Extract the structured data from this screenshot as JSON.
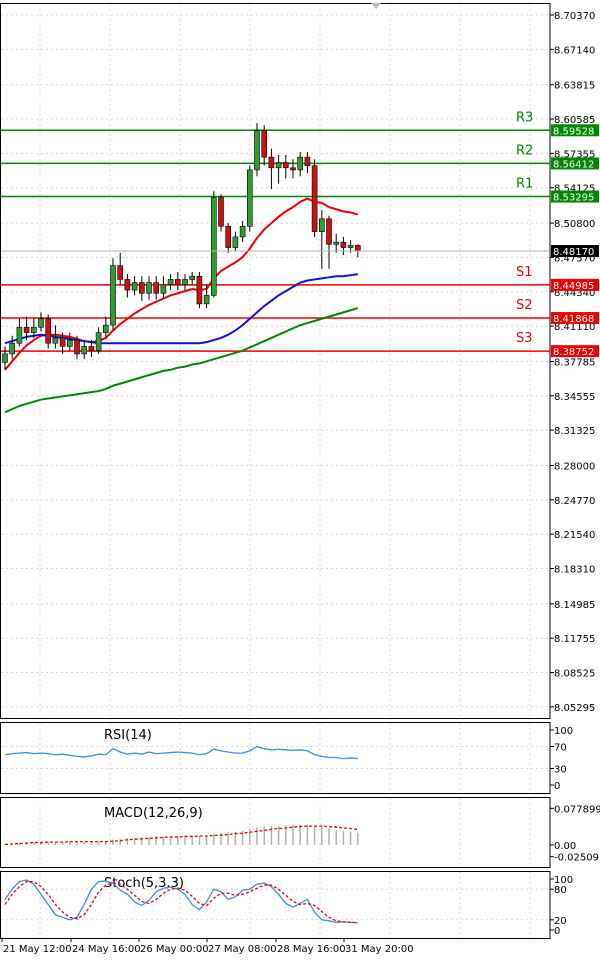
{
  "chart_data": [
    {
      "type": "candlestick",
      "title": "",
      "x_labels": [
        "21 May 12:00",
        "24 May 16:00",
        "26 May 00:00",
        "27 May 08:00",
        "28 May 16:00",
        "31 May 20:00"
      ],
      "ylim": [
        8.0425,
        8.715
      ],
      "y_ticks": [
        "8.70370",
        "8.67140",
        "8.63815",
        "8.60585",
        "8.57355",
        "8.54125",
        "8.50800",
        "8.47570",
        "8.44340",
        "8.41110",
        "8.37785",
        "8.34555",
        "8.31325",
        "8.28000",
        "8.24770",
        "8.21540",
        "8.18310",
        "8.14985",
        "8.11755",
        "8.08525",
        "8.05295"
      ],
      "grid": true,
      "candles": [
        [
          8.377,
          8.385,
          8.392,
          8.37
        ],
        [
          8.385,
          8.395,
          8.402,
          8.38
        ],
        [
          8.395,
          8.41,
          8.418,
          8.392
        ],
        [
          8.41,
          8.405,
          8.42,
          8.398
        ],
        [
          8.405,
          8.41,
          8.418,
          8.4
        ],
        [
          8.41,
          8.418,
          8.424,
          8.406
        ],
        [
          8.418,
          8.395,
          8.422,
          8.39
        ],
        [
          8.395,
          8.4,
          8.412,
          8.39
        ],
        [
          8.4,
          8.392,
          8.405,
          8.385
        ],
        [
          8.392,
          8.398,
          8.405,
          8.388
        ],
        [
          8.398,
          8.385,
          8.402,
          8.38
        ],
        [
          8.385,
          8.392,
          8.398,
          8.38
        ],
        [
          8.392,
          8.388,
          8.398,
          8.382
        ],
        [
          8.388,
          8.405,
          8.41,
          8.385
        ],
        [
          8.405,
          8.412,
          8.42,
          8.4
        ],
        [
          8.412,
          8.468,
          8.475,
          8.408
        ],
        [
          8.468,
          8.455,
          8.48,
          8.45
        ],
        [
          8.455,
          8.445,
          8.46,
          8.438
        ],
        [
          8.445,
          8.452,
          8.458,
          8.44
        ],
        [
          8.452,
          8.442,
          8.458,
          8.435
        ],
        [
          8.442,
          8.452,
          8.458,
          8.436
        ],
        [
          8.452,
          8.442,
          8.458,
          8.436
        ],
        [
          8.442,
          8.45,
          8.458,
          8.438
        ],
        [
          8.45,
          8.455,
          8.46,
          8.445
        ],
        [
          8.455,
          8.45,
          8.462,
          8.445
        ],
        [
          8.45,
          8.455,
          8.46,
          8.445
        ],
        [
          8.455,
          8.458,
          8.462,
          8.45
        ],
        [
          8.458,
          8.432,
          8.462,
          8.428
        ],
        [
          8.432,
          8.44,
          8.45,
          8.428
        ],
        [
          8.44,
          8.532,
          8.538,
          8.438
        ],
        [
          8.532,
          8.505,
          8.535,
          8.5
        ],
        [
          8.505,
          8.485,
          8.508,
          8.48
        ],
        [
          8.485,
          8.495,
          8.5,
          8.482
        ],
        [
          8.495,
          8.505,
          8.51,
          8.49
        ],
        [
          8.505,
          8.558,
          8.562,
          8.5
        ],
        [
          8.558,
          8.595,
          8.602,
          8.552
        ],
        [
          8.595,
          8.57,
          8.6,
          8.562
        ],
        [
          8.57,
          8.56,
          8.578,
          8.54
        ],
        [
          8.56,
          8.565,
          8.572,
          8.545
        ],
        [
          8.565,
          8.56,
          8.572,
          8.55
        ],
        [
          8.56,
          8.558,
          8.568,
          8.55
        ],
        [
          8.558,
          8.57,
          8.575,
          8.552
        ],
        [
          8.57,
          8.562,
          8.575,
          8.555
        ],
        [
          8.562,
          8.5,
          8.568,
          8.495
        ],
        [
          8.5,
          8.512,
          8.52,
          8.465
        ],
        [
          8.512,
          8.488,
          8.515,
          8.465
        ],
        [
          8.488,
          8.49,
          8.498,
          8.48
        ],
        [
          8.49,
          8.485,
          8.495,
          8.478
        ],
        [
          8.485,
          8.487,
          8.492,
          8.48
        ],
        [
          8.487,
          8.482,
          8.488,
          8.476
        ]
      ],
      "series": [
        {
          "name": "",
          "color": "#ee0000",
          "values": [
            8.37,
            8.378,
            8.386,
            8.393,
            8.398,
            8.402,
            8.403,
            8.403,
            8.402,
            8.401,
            8.399,
            8.397,
            8.396,
            8.397,
            8.4,
            8.407,
            8.413,
            8.418,
            8.423,
            8.427,
            8.431,
            8.434,
            8.437,
            8.44,
            8.442,
            8.444,
            8.446,
            8.445,
            8.446,
            8.456,
            8.463,
            8.467,
            8.471,
            8.476,
            8.484,
            8.494,
            8.502,
            8.508,
            8.514,
            8.519,
            8.523,
            8.528,
            8.531,
            8.528,
            8.527,
            8.523,
            8.521,
            8.519,
            8.518,
            8.516
          ]
        },
        {
          "name": "",
          "color": "#1010dd",
          "values": [
            8.395,
            8.397,
            8.399,
            8.401,
            8.402,
            8.403,
            8.402,
            8.401,
            8.4,
            8.399,
            8.398,
            8.397,
            8.396,
            8.395,
            8.395,
            8.395,
            8.395,
            8.395,
            8.395,
            8.395,
            8.395,
            8.395,
            8.395,
            8.395,
            8.395,
            8.395,
            8.395,
            8.395,
            8.396,
            8.398,
            8.4,
            8.403,
            8.407,
            8.412,
            8.418,
            8.424,
            8.43,
            8.435,
            8.44,
            8.444,
            8.448,
            8.452,
            8.454,
            8.455,
            8.456,
            8.457,
            8.458,
            8.458,
            8.459,
            8.46
          ]
        },
        {
          "name": "",
          "color": "#008800",
          "values": [
            8.33,
            8.333,
            8.336,
            8.338,
            8.34,
            8.342,
            8.343,
            8.344,
            8.345,
            8.346,
            8.347,
            8.348,
            8.349,
            8.35,
            8.352,
            8.355,
            8.357,
            8.359,
            8.361,
            8.363,
            8.365,
            8.367,
            8.369,
            8.37,
            8.372,
            8.373,
            8.375,
            8.376,
            8.378,
            8.38,
            8.382,
            8.384,
            8.386,
            8.388,
            8.391,
            8.394,
            8.397,
            8.4,
            8.403,
            8.406,
            8.409,
            8.412,
            8.414,
            8.416,
            8.418,
            8.42,
            8.422,
            8.424,
            8.426,
            8.428
          ]
        }
      ],
      "levels": [
        {
          "label": "R3",
          "value": 8.59528,
          "text": "8.59528",
          "color": "#008800"
        },
        {
          "label": "R2",
          "value": 8.56412,
          "text": "8.56412",
          "color": "#008800"
        },
        {
          "label": "R1",
          "value": 8.53295,
          "text": "8.53295",
          "color": "#008800"
        },
        {
          "label": "S1",
          "value": 8.44985,
          "text": "8.44985",
          "color": "#ee0000"
        },
        {
          "label": "S2",
          "value": 8.41868,
          "text": "8.41868",
          "color": "#ee0000"
        },
        {
          "label": "S3",
          "value": 8.38752,
          "text": "8.38752",
          "color": "#ee0000"
        }
      ],
      "current_price": {
        "value": 8.4817,
        "text": "8.48170"
      }
    },
    {
      "type": "line",
      "title": "RSI(14)",
      "ylim": [
        0,
        100
      ],
      "y_ticks": [
        "100",
        "70",
        "30",
        "0"
      ],
      "series": [
        {
          "name": "",
          "color": "#3a8fe0",
          "values": [
            55,
            57,
            58,
            59,
            57,
            58,
            57,
            55,
            56,
            54,
            52,
            51,
            53,
            56,
            55,
            66,
            60,
            56,
            58,
            56,
            60,
            57,
            58,
            59,
            60,
            59,
            58,
            55,
            57,
            65,
            62,
            60,
            58,
            58,
            62,
            70,
            66,
            64,
            65,
            64,
            63,
            64,
            62,
            55,
            52,
            50,
            50,
            48,
            49,
            48
          ]
        }
      ]
    },
    {
      "type": "bar",
      "title": "MACD(12,26,9)",
      "ylim": [
        -0.03,
        0.085
      ],
      "y_ticks": [
        "0.077899",
        "0.00",
        "-0.02509"
      ],
      "series": [
        {
          "name": "",
          "color": "#b0b0b0",
          "values": [
            0.002,
            0.003,
            0.004,
            0.005,
            0.006,
            0.007,
            0.007,
            0.007,
            0.007,
            0.007,
            0.007,
            0.007,
            0.007,
            0.007,
            0.008,
            0.011,
            0.013,
            0.014,
            0.015,
            0.016,
            0.017,
            0.018,
            0.018,
            0.019,
            0.019,
            0.02,
            0.02,
            0.019,
            0.019,
            0.024,
            0.026,
            0.027,
            0.028,
            0.03,
            0.033,
            0.037,
            0.039,
            0.04,
            0.041,
            0.042,
            0.043,
            0.043,
            0.043,
            0.04,
            0.038,
            0.035,
            0.032,
            0.03,
            0.028,
            0.026
          ]
        },
        {
          "name": "",
          "color": "#ee0000",
          "values": [
            0.001,
            0.002,
            0.003,
            0.004,
            0.005,
            0.005,
            0.006,
            0.006,
            0.006,
            0.007,
            0.007,
            0.007,
            0.007,
            0.007,
            0.007,
            0.008,
            0.009,
            0.011,
            0.012,
            0.013,
            0.014,
            0.015,
            0.016,
            0.017,
            0.017,
            0.018,
            0.018,
            0.019,
            0.019,
            0.02,
            0.021,
            0.022,
            0.024,
            0.025,
            0.027,
            0.029,
            0.031,
            0.033,
            0.035,
            0.036,
            0.038,
            0.039,
            0.04,
            0.04,
            0.04,
            0.039,
            0.038,
            0.036,
            0.035,
            0.033
          ]
        }
      ]
    },
    {
      "type": "line",
      "title": "Stoch(5,3,3)",
      "ylim": [
        0,
        100
      ],
      "y_ticks": [
        "100",
        "80",
        "20",
        "0"
      ],
      "series": [
        {
          "name": "",
          "color": "#3a8fe0",
          "values": [
            60,
            80,
            95,
            98,
            90,
            70,
            50,
            30,
            25,
            20,
            25,
            50,
            80,
            95,
            96,
            92,
            78,
            70,
            55,
            48,
            58,
            75,
            82,
            84,
            80,
            70,
            50,
            40,
            55,
            80,
            75,
            60,
            65,
            78,
            80,
            90,
            92,
            85,
            70,
            52,
            45,
            52,
            60,
            35,
            20,
            18,
            15,
            16,
            15,
            14
          ]
        },
        {
          "name": "",
          "color": "#ee0000",
          "values": [
            50,
            70,
            85,
            95,
            95,
            85,
            70,
            50,
            35,
            25,
            22,
            30,
            50,
            75,
            88,
            92,
            90,
            80,
            68,
            56,
            52,
            60,
            72,
            80,
            82,
            78,
            66,
            52,
            48,
            62,
            72,
            72,
            68,
            70,
            75,
            82,
            88,
            88,
            80,
            68,
            56,
            50,
            52,
            48,
            36,
            25,
            18,
            16,
            15,
            15
          ]
        }
      ]
    }
  ]
}
